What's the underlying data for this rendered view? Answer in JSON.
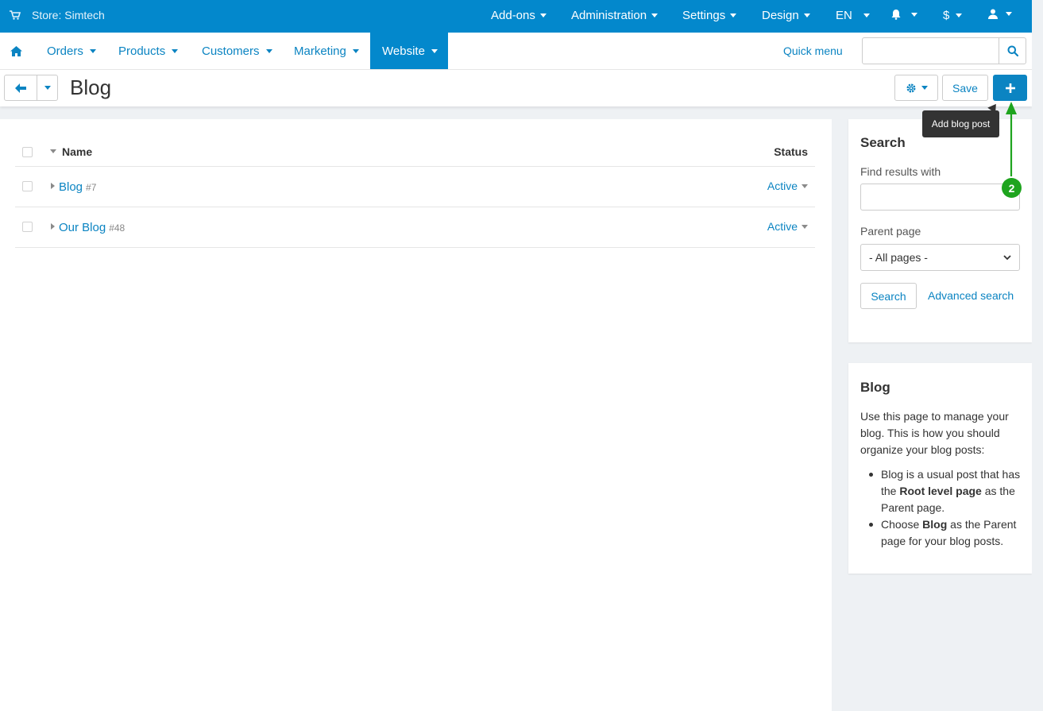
{
  "topbar": {
    "store_label": "Store: Simtech",
    "menus": [
      "Add-ons",
      "Administration",
      "Settings",
      "Design",
      "EN"
    ],
    "currency": "$"
  },
  "navbar": {
    "items": [
      "Orders",
      "Products",
      "Customers",
      "Marketing",
      "Website"
    ],
    "active": "Website",
    "quick_menu": "Quick menu",
    "search_value": ""
  },
  "toolbar": {
    "title": "Blog",
    "save_label": "Save",
    "tooltip": "Add blog post"
  },
  "table": {
    "columns": {
      "name": "Name",
      "status": "Status"
    },
    "rows": [
      {
        "name": "Blog",
        "id": "#7",
        "status": "Active"
      },
      {
        "name": "Our Blog",
        "id": "#48",
        "status": "Active"
      }
    ]
  },
  "search_panel": {
    "title": "Search",
    "find_label": "Find results with",
    "find_value": "",
    "parent_label": "Parent page",
    "parent_value": "- All pages -",
    "search_button": "Search",
    "advanced_link": "Advanced search"
  },
  "help_panel": {
    "title": "Blog",
    "intro": "Use this page to manage your blog. This is how you should organize your blog posts:",
    "bullets": [
      {
        "pre": "Blog is a usual post that has the ",
        "bold": "Root level page",
        "post": " as the Parent page."
      },
      {
        "pre": "Choose ",
        "bold": "Blog",
        "post": " as the Parent page for your blog posts."
      }
    ]
  },
  "annotation": {
    "step_number": "2",
    "color": "#1ea41e"
  },
  "colors": {
    "brand": "#0388cc",
    "link": "#0b84c2"
  }
}
